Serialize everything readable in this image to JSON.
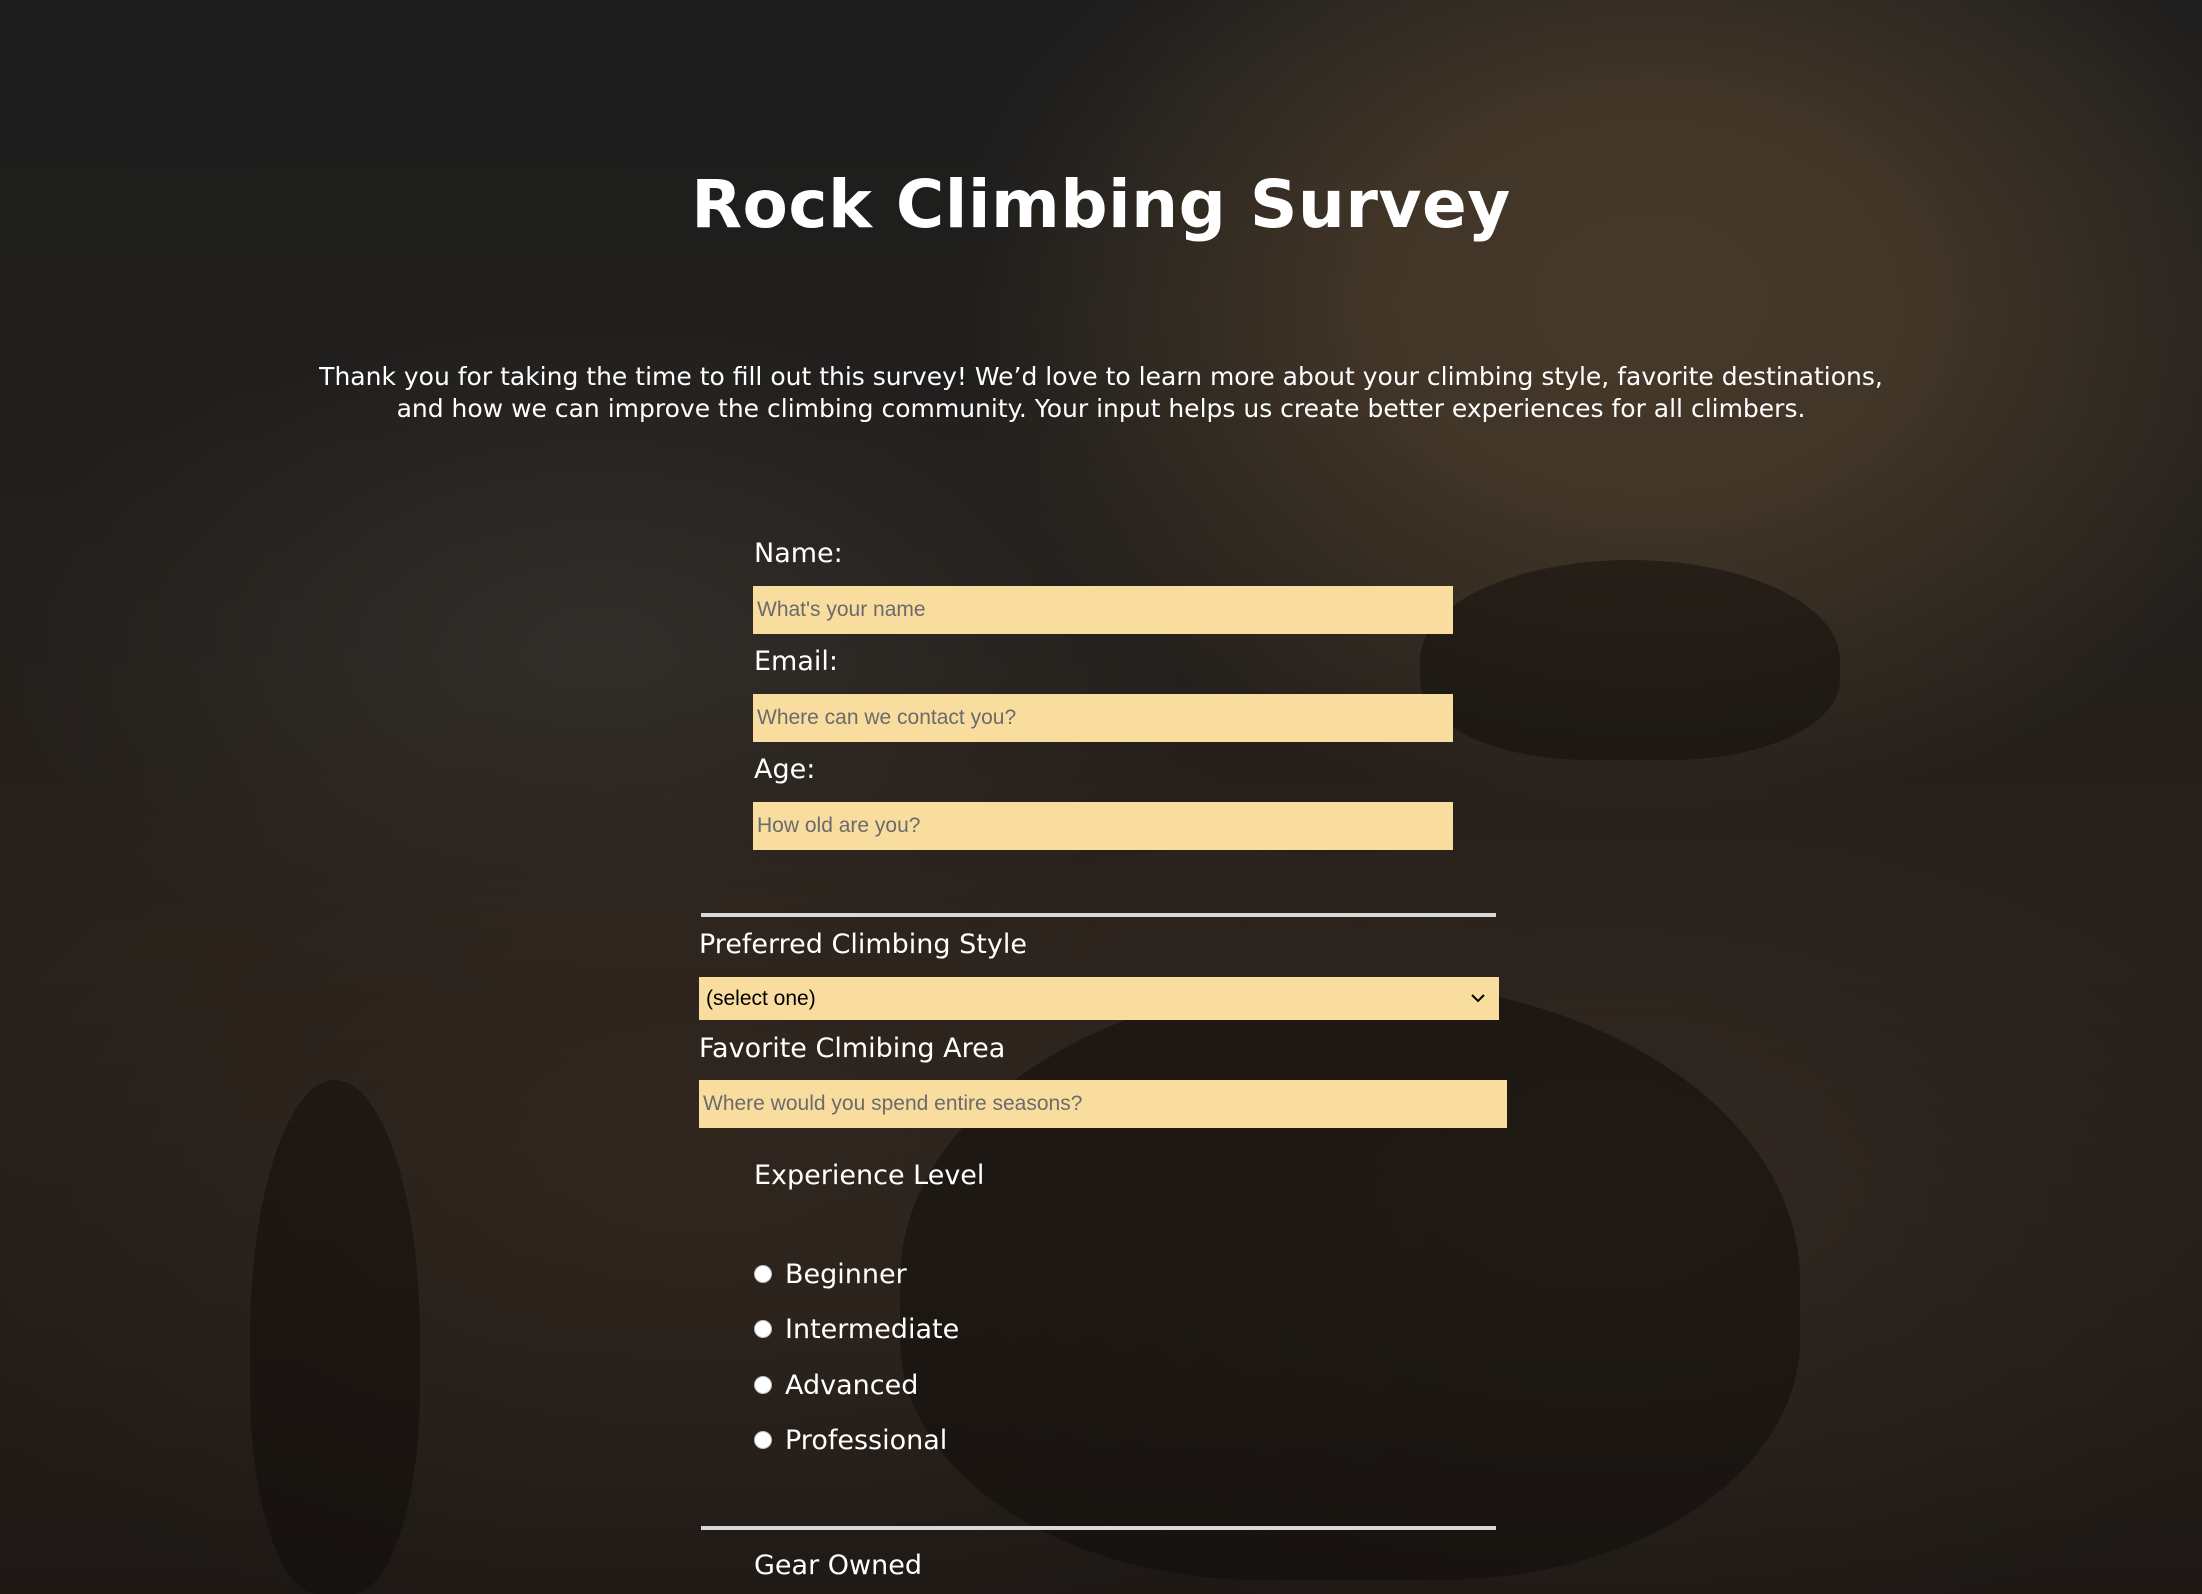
{
  "page": {
    "title": "Rock Climbing Survey",
    "description": "Thank you for taking the time to fill out this survey! We’d love to learn more about your climbing style, favorite destinations, and how we can improve the climbing community. Your input helps us create better experiences for all climbers."
  },
  "form": {
    "name": {
      "label": "Name:",
      "placeholder": "What's your name",
      "value": ""
    },
    "email": {
      "label": "Email:",
      "placeholder": "Where can we contact you?",
      "value": ""
    },
    "age": {
      "label": "Age:",
      "placeholder": "How old are you?",
      "value": ""
    },
    "climbing_style": {
      "label": "Preferred Climbing Style",
      "selected": "(select one)"
    },
    "favorite_area": {
      "label": "Favorite Clmibing Area",
      "placeholder": "Where would you spend entire seasons?",
      "value": ""
    },
    "experience": {
      "label": "Experience Level",
      "options": [
        "Beginner",
        "Intermediate",
        "Advanced",
        "Professional"
      ]
    },
    "gear": {
      "label": "Gear Owned"
    }
  },
  "colors": {
    "input_background": "#f8dd9f",
    "text": "#ffffff",
    "divider": "#d8d8d8"
  },
  "icons": {
    "select_arrow": "chevron-down-icon"
  }
}
